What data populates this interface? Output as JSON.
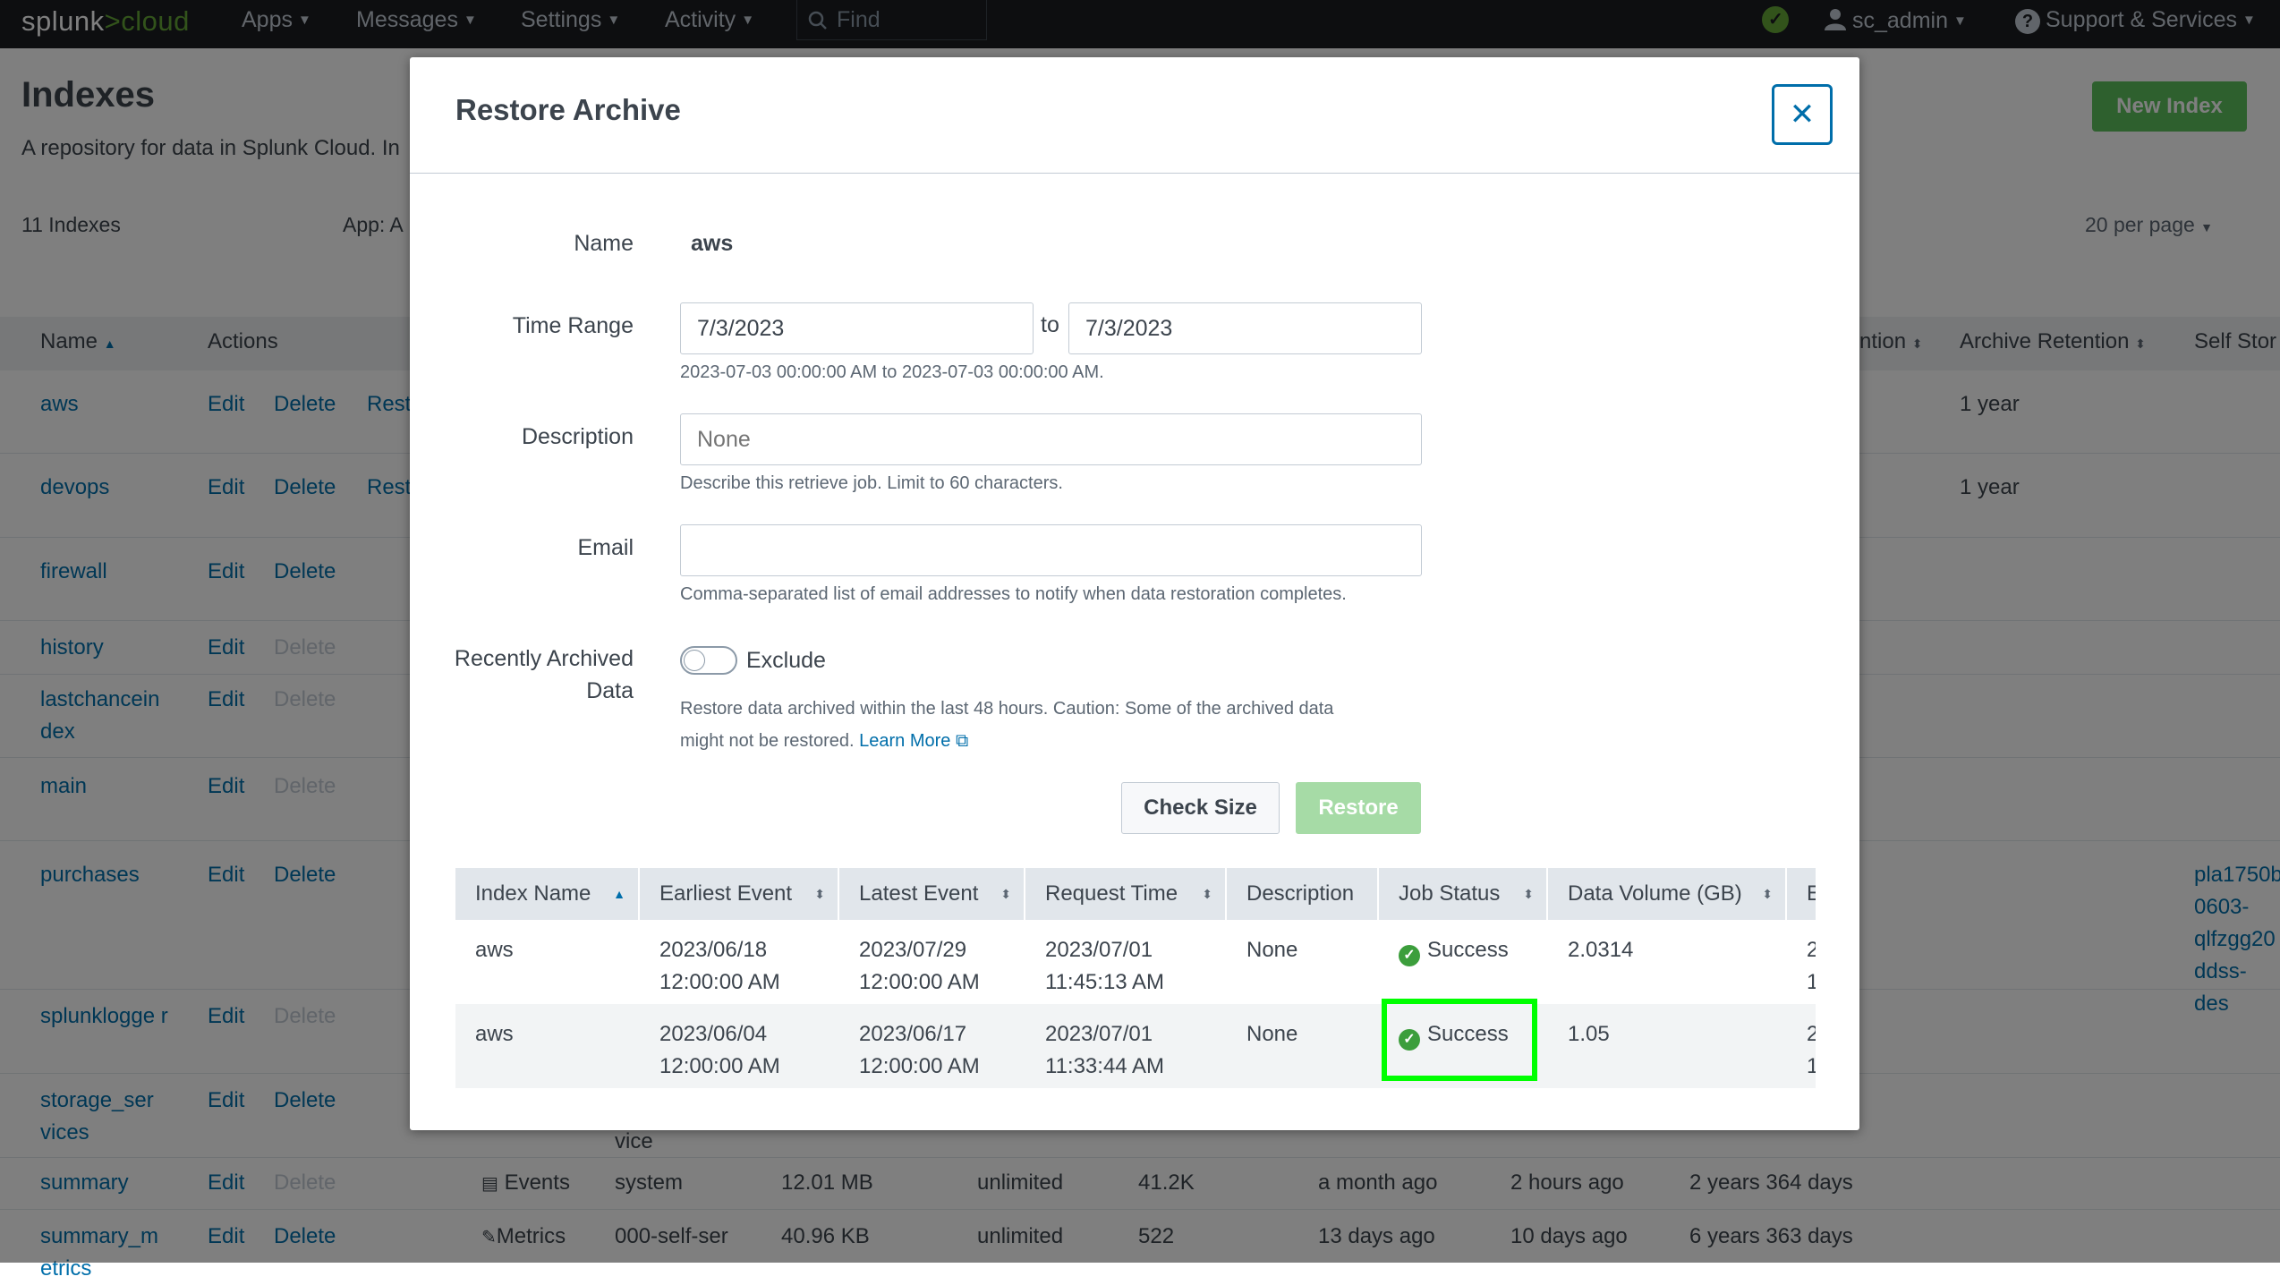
{
  "topnav": {
    "logo_splunk": "splunk",
    "logo_chevron": ">",
    "logo_cloud": "cloud",
    "items": [
      "Apps",
      "Messages",
      "Settings",
      "Activity"
    ],
    "find_placeholder": "Find",
    "user": "sc_admin",
    "support": "Support & Services",
    "health_status_color": "#65a637"
  },
  "page": {
    "title": "Indexes",
    "subtitle": "A repository for data in Splunk Cloud. In",
    "new_index_label": "New Index",
    "count_label": "11 Indexes",
    "app_label": "App: A",
    "per_page": "20 per page",
    "columns": [
      "Name",
      "Actions",
      "ntion",
      "Archive Retention",
      "Self Stor"
    ],
    "rows": [
      {
        "name": "aws",
        "edit": "Edit",
        "delete": "Delete",
        "restore": "Rest",
        "archive": "1 year"
      },
      {
        "name": "devops",
        "edit": "Edit",
        "delete": "Delete",
        "restore": "Rest",
        "archive": "1 year"
      },
      {
        "name": "firewall",
        "edit": "Edit",
        "delete": "Delete"
      },
      {
        "name": "history",
        "edit": "Edit",
        "delete": "Delete"
      },
      {
        "name": "lastchancein dex",
        "edit": "Edit",
        "delete": "Delete"
      },
      {
        "name": "main",
        "edit": "Edit",
        "delete": "Delete"
      },
      {
        "name": "purchases",
        "edit": "Edit",
        "delete": "Delete",
        "self_storage": "pla1750b 0603- qlfzgg20 ddss-des"
      },
      {
        "name": "splunklogge r",
        "edit": "Edit",
        "delete": "Delete"
      },
      {
        "name": "storage_ser vices",
        "edit": "Edit",
        "delete": "Delete",
        "app_fragment": "vice"
      },
      {
        "name": "summary",
        "edit": "Edit",
        "delete": "Delete",
        "type": "Events",
        "app": "system",
        "size": "12.01 MB",
        "max": "unlimited",
        "count": "41.2K",
        "earliest": "a month ago",
        "latest": "2 hours ago",
        "retention": "2 years 364 days"
      },
      {
        "name": "summary_m etrics",
        "edit": "Edit",
        "delete": "Delete",
        "type": "Metrics",
        "app": "000-self-ser",
        "size": "40.96 KB",
        "max": "unlimited",
        "count": "522",
        "earliest": "13 days ago",
        "latest": "10 days ago",
        "retention": "6 years 363 days"
      }
    ]
  },
  "modal": {
    "title": "Restore Archive",
    "close_icon": "close-icon",
    "name_label": "Name",
    "name_value": "aws",
    "time_range_label": "Time Range",
    "time_from": "7/3/2023",
    "time_to_label": "to",
    "time_to": "7/3/2023",
    "time_help": "2023-07-03 00:00:00 AM to 2023-07-03 00:00:00 AM.",
    "description_label": "Description",
    "description_placeholder": "None",
    "description_help": "Describe this retrieve job. Limit to 60 characters.",
    "email_label": "Email",
    "email_value": "",
    "email_help": "Comma-separated list of email addresses to notify when data restoration completes.",
    "recent_label_1": "Recently Archived",
    "recent_label_2": "Data",
    "toggle_label": "Exclude",
    "toggle_on": false,
    "recent_help_1": "Restore data archived within the last 48 hours. Caution: Some of the archived data",
    "recent_help_2": "might not be restored.",
    "learn_more": "Learn More",
    "check_size_label": "Check Size",
    "restore_label": "Restore"
  },
  "jobs": {
    "columns": [
      "Index Name",
      "Earliest Event",
      "Latest Event",
      "Request Time",
      "Description",
      "Job Status",
      "Data Volume (GB)",
      "E"
    ],
    "rows": [
      {
        "index": "aws",
        "earliest_1": "2023/06/18",
        "earliest_2": "12:00:00 AM",
        "latest_1": "2023/07/29",
        "latest_2": "12:00:00 AM",
        "request_1": "2023/07/01",
        "request_2": "11:45:13 AM",
        "description": "None",
        "status": "Success",
        "volume": "2.0314",
        "extra_1": "2",
        "extra_2": "1"
      },
      {
        "index": "aws",
        "earliest_1": "2023/06/04",
        "earliest_2": "12:00:00 AM",
        "latest_1": "2023/06/17",
        "latest_2": "12:00:00 AM",
        "request_1": "2023/07/01",
        "request_2": "11:33:44 AM",
        "description": "None",
        "status": "Success",
        "volume": "1.05",
        "extra_1": "2",
        "extra_2": "1"
      }
    ]
  },
  "colors": {
    "accent": "#006eaa",
    "success": "#3c9e3c",
    "highlight": "#00ff00"
  }
}
